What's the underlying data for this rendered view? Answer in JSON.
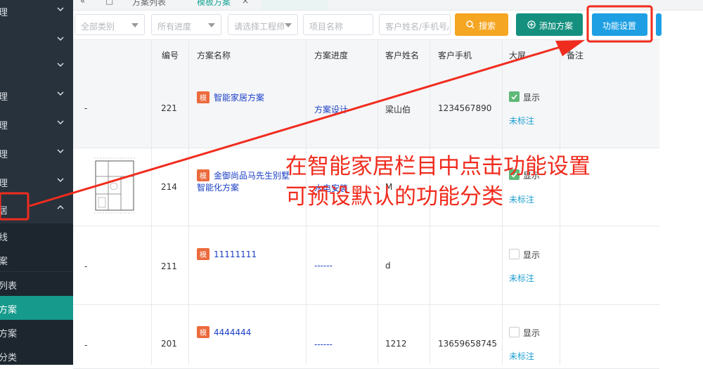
{
  "sidebar": {
    "items": [
      {
        "label": "理"
      },
      {
        "label": ""
      },
      {
        "label": "理"
      },
      {
        "label": "理"
      },
      {
        "label": "理"
      },
      {
        "label": "理"
      },
      {
        "label": "居"
      }
    ],
    "subitems": [
      {
        "label": "线"
      },
      {
        "label": "案"
      },
      {
        "label": "列表"
      },
      {
        "label": "方案"
      },
      {
        "label": "方案"
      },
      {
        "label": "分类"
      }
    ]
  },
  "tabs": {
    "collapse": "«",
    "home": "□",
    "list": "方案列表",
    "active": "模板方案",
    "close": "×"
  },
  "filters": {
    "category": "全部类别",
    "progress": "所有进度",
    "engineer": "请选择工程师",
    "project": "项目名称",
    "customer": "客户姓名/手机号/",
    "search": "搜索",
    "add": "添加方案",
    "settings": "功能设置"
  },
  "table": {
    "headers": [
      "编号",
      "方案名称",
      "方案进度",
      "客户姓名",
      "客户手机",
      "大屏",
      "备注"
    ],
    "rows": [
      {
        "img": "-",
        "id": "221",
        "badge": "模",
        "name": "智能家居方案",
        "name2": "",
        "progress": "方案设计",
        "customer": "梁山伯",
        "phone": "1234567890",
        "screen_checked": true,
        "screen": "显示",
        "mark": "未标注"
      },
      {
        "img": "",
        "id": "214",
        "badge": "模",
        "name": "金御尚品马先生别墅",
        "name2": "智能化方案",
        "progress": "水电安装",
        "customer": "M",
        "phone": "",
        "screen_checked": true,
        "screen": "显示",
        "mark": "未标注"
      },
      {
        "img": "-",
        "id": "211",
        "badge": "模",
        "name": "11111111",
        "name2": "",
        "progress": "------",
        "customer": "d",
        "phone": "",
        "screen_checked": false,
        "screen": "显示",
        "mark": "未标注"
      },
      {
        "img": "-",
        "id": "201",
        "badge": "模",
        "name": "4444444",
        "name2": "",
        "progress": "------",
        "customer": "1212",
        "phone": "13659658745",
        "screen_checked": false,
        "screen": "显示",
        "mark": "未标注"
      }
    ]
  },
  "annotation": {
    "line1": "在智能家居栏目中点击功能设置",
    "line2": "可预设默认的功能分类"
  },
  "colors": {
    "annotation": "#f02c1e",
    "sidebar": "#28323c",
    "active_menu": "#159a8c",
    "search_btn": "#f5a623",
    "add_btn": "#15907f",
    "settings_btn": "#1e9fe3"
  }
}
